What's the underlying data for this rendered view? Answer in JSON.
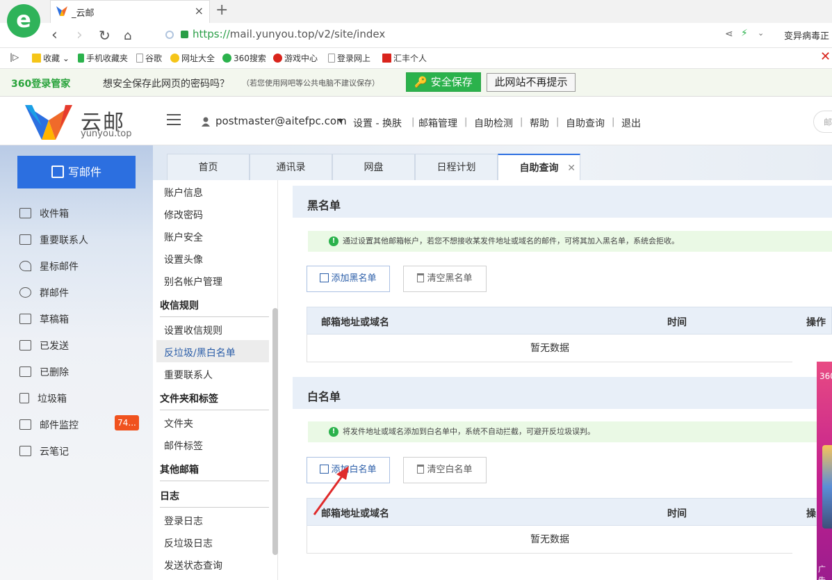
{
  "browser": {
    "tab_title": "_云邮",
    "url_scheme": "https://",
    "url_host": "mail.yunyou.top",
    "url_path": "/v2/site/index",
    "right_text": "变异病毒正"
  },
  "bookmarks": [
    "收藏",
    "手机收藏夹",
    "谷歌",
    "网址大全",
    "360搜索",
    "游戏中心",
    "登录网上",
    "汇丰个人"
  ],
  "password_bar": {
    "brand": "360登录管家",
    "question": "想安全保存此网页的密码吗？",
    "note": "（若您使用网吧等公共电脑不建议保存）",
    "save": "安全保存",
    "never": "此网站不再提示"
  },
  "app": {
    "logo_name": "云邮",
    "logo_sub": "yunyou.top",
    "user_email": "postmaster@aitefpc.com",
    "top_links": [
      "设置 - 换肤",
      "邮箱管理",
      "自助检测",
      "帮助",
      "自助查询",
      "退出"
    ],
    "search_hint": "邮"
  },
  "sidebar": {
    "compose": "写邮件",
    "items": [
      {
        "label": "收件箱",
        "icon": "inbox-icon"
      },
      {
        "label": "重要联系人",
        "icon": "contact-icon"
      },
      {
        "label": "星标邮件",
        "icon": "star-icon"
      },
      {
        "label": "群邮件",
        "icon": "group-icon"
      },
      {
        "label": "草稿箱",
        "icon": "draft-icon"
      },
      {
        "label": "已发送",
        "icon": "sent-icon"
      },
      {
        "label": "已删除",
        "icon": "deleted-icon"
      },
      {
        "label": "垃圾箱",
        "icon": "trash-icon"
      },
      {
        "label": "邮件监控",
        "icon": "monitor-icon"
      },
      {
        "label": "云笔记",
        "icon": "note-icon"
      }
    ],
    "monitor_badge": "74..."
  },
  "tabs": [
    "首页",
    "通讯录",
    "网盘",
    "日程计划",
    "自助查询"
  ],
  "settings_menu": {
    "items_top": [
      "账户信息",
      "修改密码",
      "账户安全",
      "设置头像",
      "别名帐户管理"
    ],
    "h_rules": "收信规则",
    "rules": [
      "设置收信规则",
      "反垃圾/黑白名单",
      "重要联系人"
    ],
    "h_folders": "文件夹和标签",
    "folders": [
      "文件夹",
      "邮件标签"
    ],
    "h_other": "其他邮箱",
    "h_log": "日志",
    "logs": [
      "登录日志",
      "反垃圾日志",
      "发送状态查询"
    ]
  },
  "blacklist": {
    "title": "黑名单",
    "info": "通过设置其他邮箱帐户，若您不想接收某发件地址或域名的邮件，可将其加入黑名单，系统会拒收。",
    "add": "添加黑名单",
    "clear": "清空黑名单",
    "col_addr": "邮箱地址或域名",
    "col_time": "时间",
    "col_op": "操作",
    "empty": "暂无数据"
  },
  "whitelist": {
    "title": "白名单",
    "info": "将发件地址或域名添加到白名单中，系统不自动拦截，可避开反垃圾误判。",
    "add": "添加白名单",
    "clear": "清空白名单",
    "col_addr": "邮箱地址或域名",
    "col_time": "时间",
    "col_op": "操",
    "empty": "暂无数据"
  },
  "ad": {
    "top": "360",
    "bottom": "广告"
  }
}
